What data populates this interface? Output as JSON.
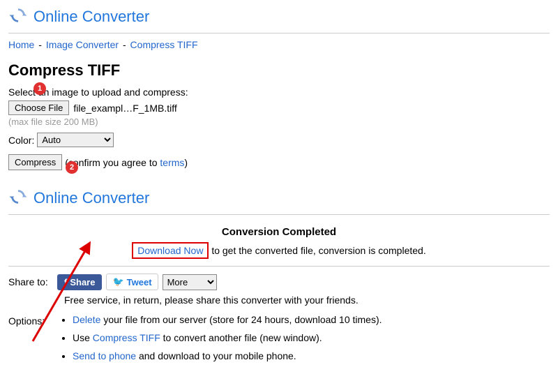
{
  "site_title": "Online Converter",
  "breadcrumb": {
    "home": "Home",
    "image_converter": "Image Converter",
    "compress_tiff": "Compress TIFF",
    "sep": " - "
  },
  "page_title": "Compress TIFF",
  "instruction": "Select an image to upload and compress:",
  "file_button": "Choose File",
  "file_name": "file_exampl…F_1MB.tiff",
  "file_note": "(max file size 200 MB)",
  "color_label": "Color:",
  "color_value": "Auto",
  "compress_button": "Compress",
  "compress_note_prefix": "(confirm you agree to ",
  "terms": "terms",
  "compress_note_suffix": ")",
  "marker1": "1",
  "marker2": "2",
  "result": {
    "heading": "Conversion Completed",
    "download": "Download Now",
    "after": " to get the converted file, conversion is completed."
  },
  "share": {
    "label": "Share to:",
    "fb": "Share",
    "tweet": "Tweet",
    "more": "More",
    "note": "Free service, in return, please share this converter with your friends."
  },
  "options": {
    "label": "Options:",
    "delete": "Delete",
    "delete_after": " your file from our server (store for 24 hours, download 10 times).",
    "use_prefix": "Use ",
    "compress_tiff": "Compress TIFF",
    "use_after": " to convert another file (new window).",
    "send": "Send to phone",
    "send_after": " and download to your mobile phone."
  }
}
